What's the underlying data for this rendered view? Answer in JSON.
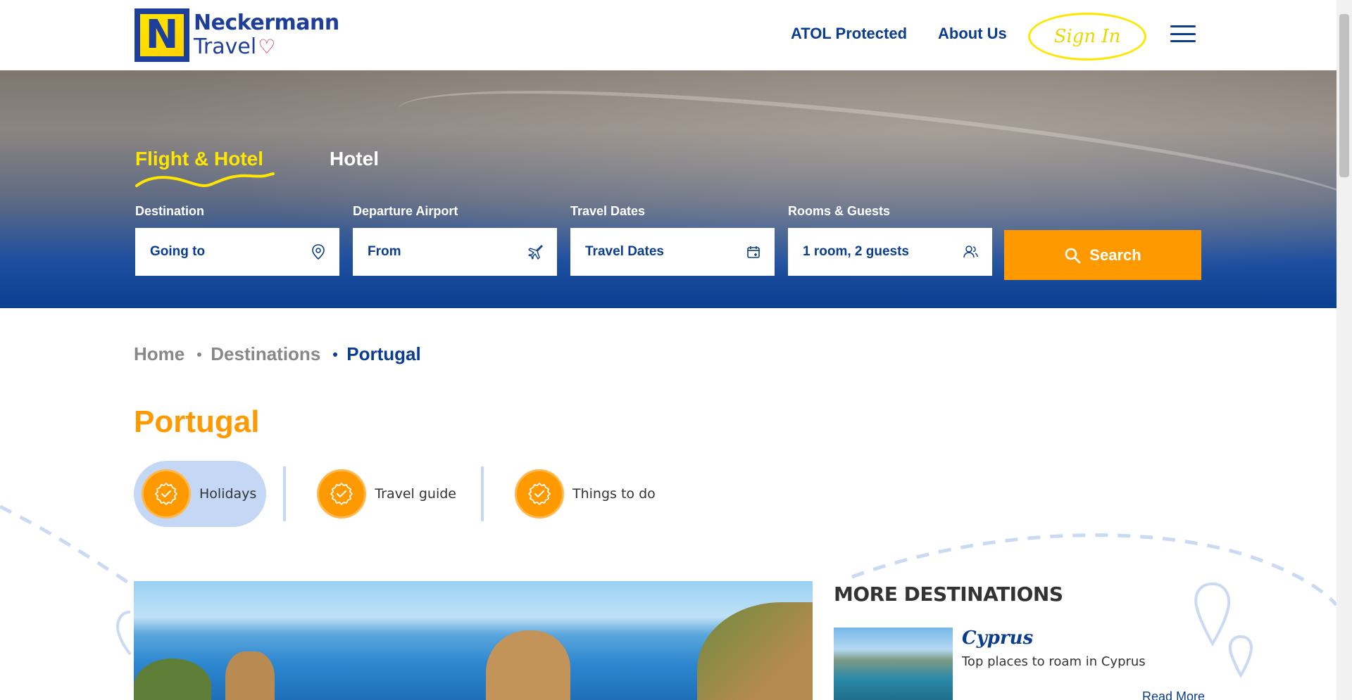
{
  "header": {
    "logo_line1": "Neckermann",
    "logo_line2": "Travel",
    "nav_atol": "ATOL Protected",
    "nav_about": "About Us",
    "sign_in": "Sign In"
  },
  "search": {
    "tabs": [
      "Flight & Hotel",
      "Hotel"
    ],
    "active_tab": "Flight & Hotel",
    "fields": [
      {
        "label": "Destination",
        "value": "Going to",
        "icon": "location-pin-icon"
      },
      {
        "label": "Departure Airport",
        "value": "From",
        "icon": "plane-icon"
      },
      {
        "label": "Travel Dates",
        "value": "Travel Dates",
        "icon": "calendar-icon"
      },
      {
        "label": "Rooms & Guests",
        "value": "1 room, 2 guests",
        "icon": "guests-icon"
      }
    ],
    "button": "Search"
  },
  "breadcrumb": [
    "Home",
    "Destinations",
    "Portugal"
  ],
  "page_title": "Portugal",
  "pills": [
    {
      "label": "Holidays",
      "active": true
    },
    {
      "label": "Travel guide",
      "active": false
    },
    {
      "label": "Things to do",
      "active": false
    }
  ],
  "more_destinations": {
    "title": "MORE DESTINATIONS",
    "items": [
      {
        "name": "Cyprus",
        "desc": "Top places to roam in Cyprus",
        "link": "Read More"
      }
    ]
  },
  "colors": {
    "brand_blue": "#0a3d8f",
    "accent_orange": "#ff9900",
    "accent_yellow": "#ffe600",
    "pill_blue": "#c4d8f5"
  }
}
